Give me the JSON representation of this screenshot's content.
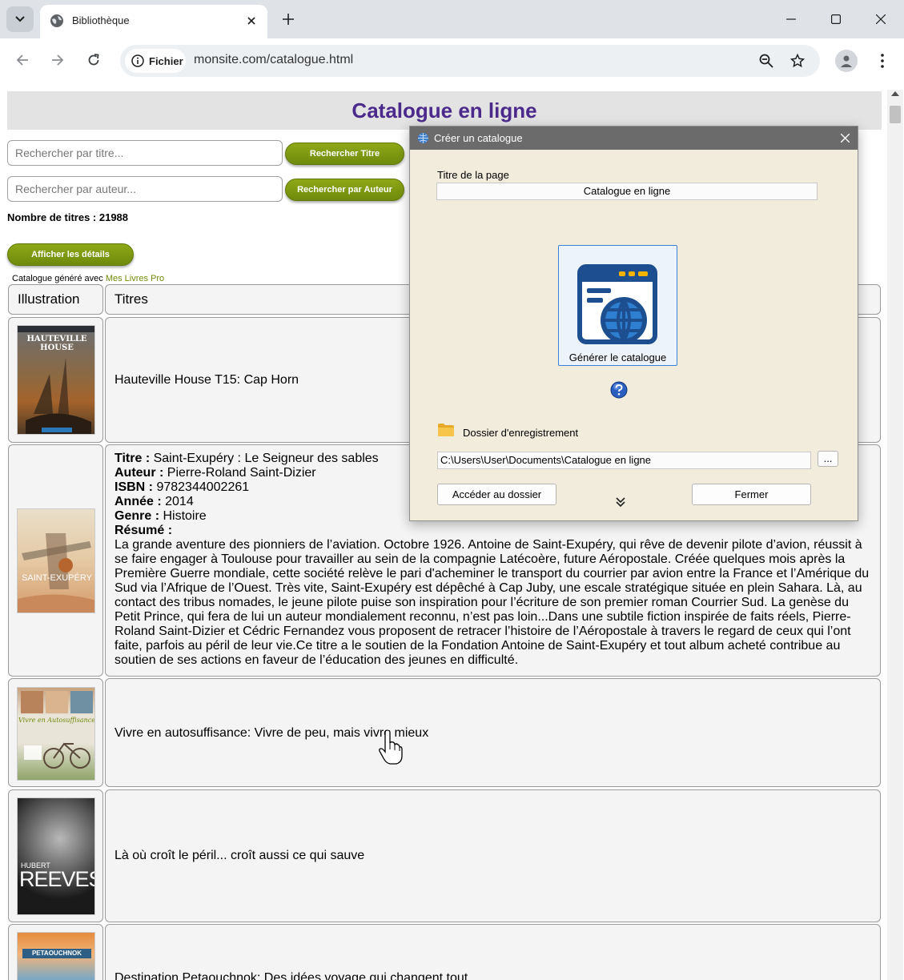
{
  "browser": {
    "tab_title": "Bibliothèque",
    "site_chip": "Fichier",
    "url": "monsite.com/catalogue.html"
  },
  "page": {
    "title": "Catalogue en ligne",
    "search_title_placeholder": "Rechercher par titre...",
    "search_title_button": "Rechercher Titre",
    "search_author_placeholder": "Rechercher par auteur...",
    "search_author_button": "Rechercher par Auteur",
    "count_label": "Nombre de titres : 21988",
    "details_button": "Afficher les détails",
    "generated_prefix": "Catalogue généré avec",
    "generated_link": "Mes Livres Pro",
    "table": {
      "col_illustration": "Illustration",
      "col_titles": "Titres",
      "rows": [
        {
          "title": "Hauteville House T15: Cap Horn"
        },
        {
          "title_label": "Titre :",
          "title": "Saint-Exupéry : Le Seigneur des sables",
          "author_label": "Auteur :",
          "author": "Pierre-Roland Saint-Dizier",
          "isbn_label": "ISBN :",
          "isbn": "9782344002261",
          "year_label": "Année :",
          "year": "2014",
          "genre_label": "Genre :",
          "genre": "Histoire",
          "summary_label": "Résumé :",
          "summary": "La grande aventure des pionniers de l’aviation. Octobre 1926. Antoine de Saint-Exupéry, qui rêve de devenir pilote d’avion, réussit à se faire engager à Toulouse pour travailler au sein de la compagnie Latécoère, future Aéropostale. Créée quelques mois après la Première Guerre mondiale, cette société relève le pari d'acheminer le transport du courrier par avion entre la France et l’Amérique du Sud via l’Afrique de l’Ouest. Très vite, Saint-Exupéry est dépêché à Cap Juby, une escale stratégique située en plein Sahara. Là, au contact des tribus nomades, le jeune pilote puise son inspiration pour l’écriture de son premier roman Courrier Sud. La genèse du Petit Prince, qui fera de lui un auteur mondialement reconnu, n’est pas loin...Dans une subtile fiction inspirée de faits réels, Pierre-Roland Saint-Dizier et Cédric Fernandez vous proposent de retracer l’histoire de l’Aéropostale à travers le regard de ceux qui l’ont faite, parfois au péril de leur vie.Ce titre a le soutien de la Fondation Antoine de Saint-Exupéry et tout album acheté contribue au soutien de ses actions en faveur de l’éducation des jeunes en difficulté."
        },
        {
          "title": "Vivre en autosuffisance: Vivre de peu, mais vivre mieux"
        },
        {
          "title": "Là où croît le péril... croît aussi ce qui sauve"
        },
        {
          "title": "Destination Petaouchnok: Des idées voyage qui changent tout"
        }
      ]
    },
    "covers": {
      "cover1_lines": [
        "HAUTEVILLE HOUSE"
      ],
      "cover2_text": "SAINT-EXUPÉRY",
      "cover3_text": "Vivre en Autosuffisance",
      "cover4_top": "HUBERT",
      "cover4_main": "REEVES",
      "cover5_text": "PETAOUCHNOK"
    }
  },
  "dialog": {
    "title": "Créer un catalogue",
    "page_title_label": "Titre de la page",
    "page_title_value": "Catalogue en ligne",
    "generate_label": "Générer le catalogue",
    "folder_label": "Dossier d'enregistrement",
    "folder_path": "C:\\Users\\User\\Documents\\Catalogue en ligne",
    "browse_label": "...",
    "open_folder_button": "Accéder au dossier",
    "close_button": "Fermer"
  },
  "colors": {
    "title_purple": "#4b2a8c",
    "button_green": "#7a960f",
    "dialog_bg": "#f1ecdc"
  }
}
